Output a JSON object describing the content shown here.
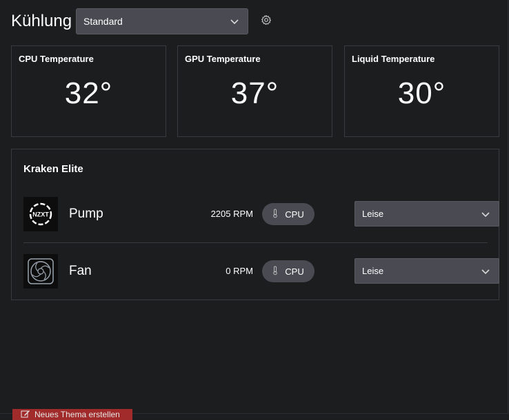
{
  "header": {
    "title": "Kühlung",
    "profile_select": {
      "value": "Standard"
    },
    "settings_icon": "gear-icon"
  },
  "temperature_cards": [
    {
      "label": "CPU Temperature",
      "value": "32°"
    },
    {
      "label": "GPU Temperature",
      "value": "37°"
    },
    {
      "label": "Liquid Temperature",
      "value": "30°"
    }
  ],
  "device": {
    "name": "Kraken Elite",
    "rows": [
      {
        "name": "Pump",
        "icon": "nzxt-logo-icon",
        "rpm": "2205 RPM",
        "source": "CPU",
        "mode": "Leise"
      },
      {
        "name": "Fan",
        "icon": "fan-icon",
        "rpm": "0 RPM",
        "source": "CPU",
        "mode": "Leise"
      }
    ]
  },
  "footer": {
    "new_theme_label": "Neues Thema erstellen",
    "accent_color": "#a12a2a"
  },
  "colors": {
    "background": "#1c1d1f",
    "control": "#4a4a52",
    "border": "#3a3b3f"
  }
}
